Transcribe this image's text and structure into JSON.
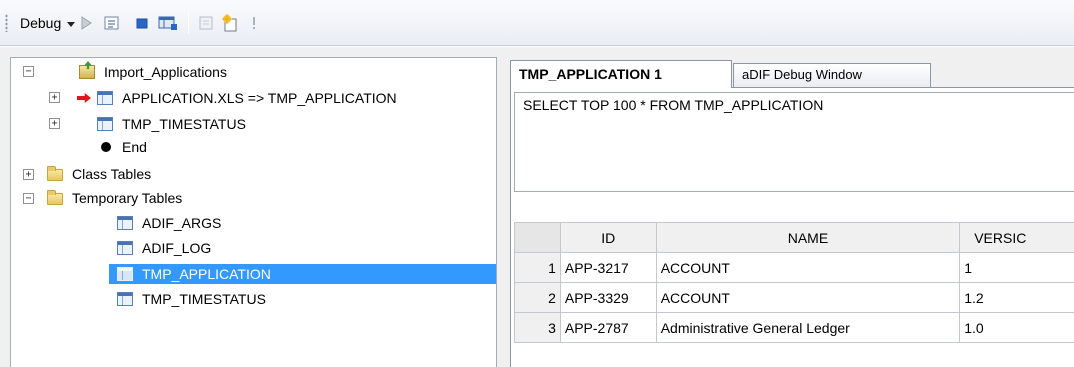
{
  "toolbar": {
    "debug_label": "Debug",
    "icons": [
      "play-icon",
      "step-into-icon",
      "stop-icon",
      "breakpoint-list-icon",
      "properties-icon",
      "new-item-icon",
      "info-icon"
    ]
  },
  "tree": {
    "root": {
      "label": "Import_Applications",
      "expanded": true
    },
    "items": [
      {
        "label": "APPLICATION.XLS => TMP_APPLICATION",
        "icon": "table-icon",
        "current": true
      },
      {
        "label": "TMP_TIMESTATUS",
        "icon": "table-icon"
      },
      {
        "label": "End",
        "icon": "end-dot-icon"
      }
    ],
    "folders": [
      {
        "label": "Class Tables",
        "expanded": false
      },
      {
        "label": "Temporary Tables",
        "expanded": true
      }
    ],
    "temporary_tables": [
      {
        "label": "ADIF_ARGS"
      },
      {
        "label": "ADIF_LOG"
      },
      {
        "label": "TMP_APPLICATION",
        "selected": true
      },
      {
        "label": "TMP_TIMESTATUS"
      }
    ]
  },
  "tabs": [
    {
      "label": "TMP_APPLICATION 1",
      "active": true
    },
    {
      "label": "aDIF Debug Window",
      "active": false
    }
  ],
  "query": "SELECT TOP 100 * FROM TMP_APPLICATION",
  "grid": {
    "columns": [
      "",
      "ID",
      "NAME",
      "VERSIC"
    ],
    "rows": [
      {
        "n": "1",
        "id": "APP-3217",
        "name": "ACCOUNT",
        "version": "1"
      },
      {
        "n": "2",
        "id": "APP-3329",
        "name": "ACCOUNT",
        "version": "1.2"
      },
      {
        "n": "3",
        "id": "APP-2787",
        "name": "Administrative General Ledger",
        "version": "1.0"
      }
    ]
  }
}
